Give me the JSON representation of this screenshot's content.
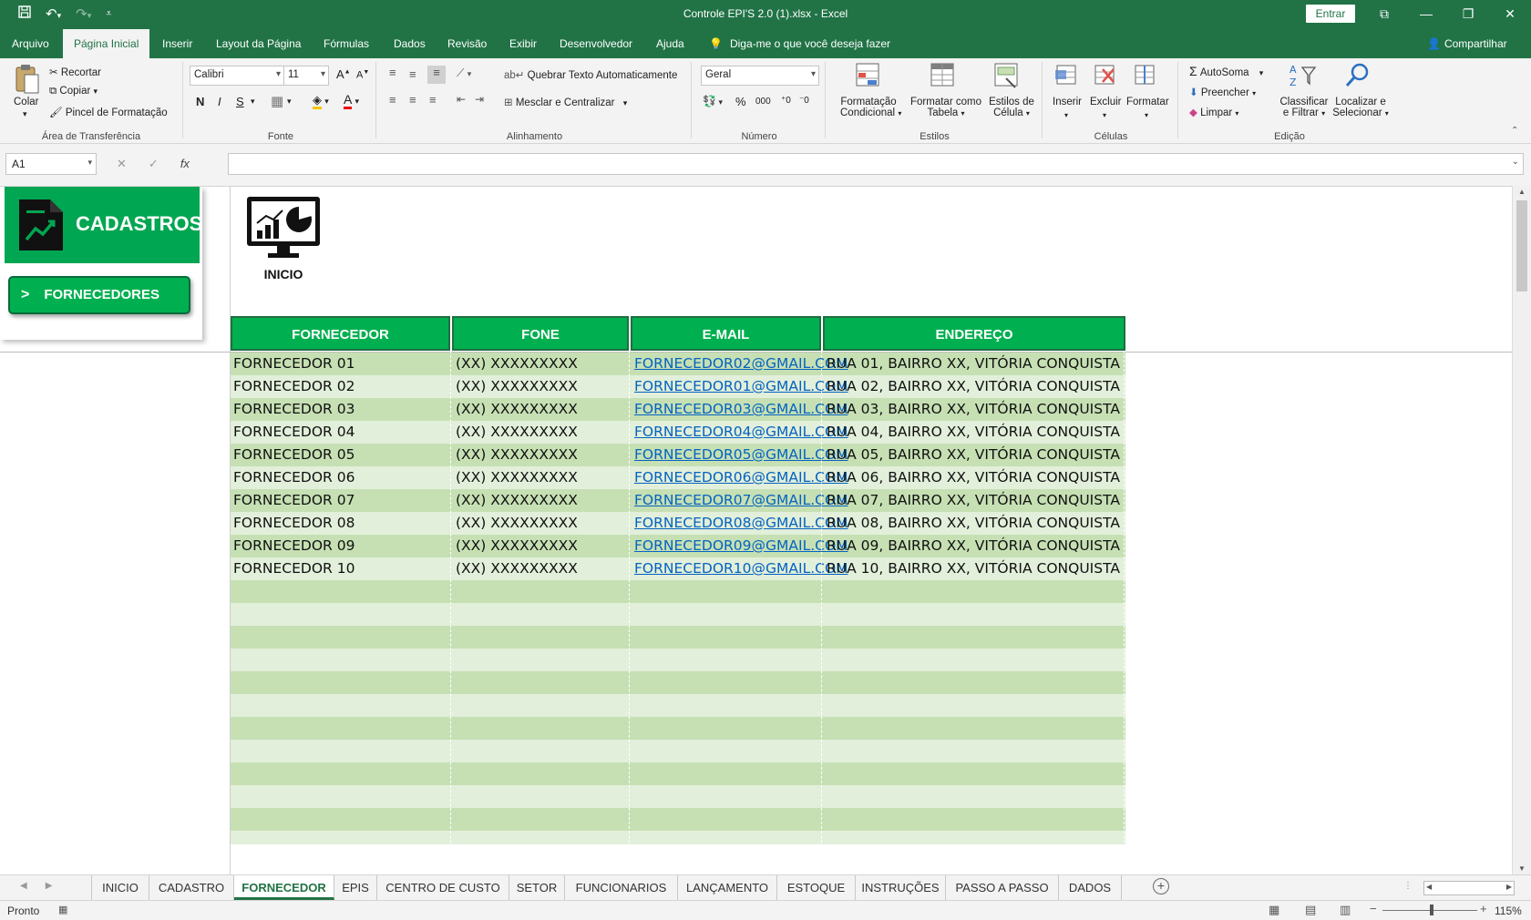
{
  "app": {
    "title": "Controle EPI'S 2.0 (1).xlsx  -  Excel",
    "signin_label": "Entrar"
  },
  "menu": {
    "tabs": [
      "Arquivo",
      "Página Inicial",
      "Inserir",
      "Layout da Página",
      "Fórmulas",
      "Dados",
      "Revisão",
      "Exibir",
      "Desenvolvedor",
      "Ajuda"
    ],
    "active_tab": "Página Inicial",
    "tell_me": "Diga-me o que você deseja fazer",
    "share": "Compartilhar"
  },
  "ribbon": {
    "clipboard": {
      "paste": "Colar",
      "cut": "Recortar",
      "copy": "Copiar",
      "format_painter": "Pincel de Formatação",
      "label": "Área de Transferência"
    },
    "font": {
      "name": "Calibri",
      "size": "11",
      "bold": "N",
      "italic": "I",
      "underline": "S",
      "label": "Fonte"
    },
    "alignment": {
      "wrap": "Quebrar Texto Automaticamente",
      "merge": "Mesclar e Centralizar",
      "label": "Alinhamento"
    },
    "number": {
      "format": "Geral",
      "label": "Número"
    },
    "styles": {
      "conditional": [
        "Formatação",
        "Condicional"
      ],
      "table": [
        "Formatar como",
        "Tabela"
      ],
      "cell": [
        "Estilos de",
        "Célula"
      ],
      "label": "Estilos"
    },
    "cells": {
      "insert": "Inserir",
      "delete": "Excluir",
      "format": "Formatar",
      "label": "Células"
    },
    "editing": {
      "autosum": "AutoSoma",
      "fill": "Preencher",
      "clear": "Limpar",
      "sort": [
        "Classificar",
        "e Filtrar"
      ],
      "find": [
        "Localizar e",
        "Selecionar"
      ],
      "label": "Edição"
    }
  },
  "formula_bar": {
    "name_box": "A1",
    "fx": "fx",
    "value": ""
  },
  "panel": {
    "title": "CADASTROS",
    "button": "FORNECEDORES",
    "button_arrow": ">",
    "inicio_label": "INICIO"
  },
  "table": {
    "headers": [
      "FORNECEDOR",
      "FONE",
      "E-MAIL",
      "ENDEREÇO"
    ],
    "rows": [
      [
        "FORNECEDOR 01",
        "(XX) XXXXXXXXX",
        "FORNECEDOR02@GMAIL.COM",
        "RUA 01, BAIRRO XX, VITÓRIA CONQUISTA"
      ],
      [
        "FORNECEDOR 02",
        "(XX) XXXXXXXXX",
        "FORNECEDOR01@GMAIL.COM",
        "RUA 02, BAIRRO XX, VITÓRIA CONQUISTA"
      ],
      [
        "FORNECEDOR 03",
        "(XX) XXXXXXXXX",
        "FORNECEDOR03@GMAIL.COM",
        "RUA 03, BAIRRO XX, VITÓRIA CONQUISTA"
      ],
      [
        "FORNECEDOR 04",
        "(XX) XXXXXXXXX",
        "FORNECEDOR04@GMAIL.COM",
        "RUA 04, BAIRRO XX, VITÓRIA CONQUISTA"
      ],
      [
        "FORNECEDOR 05",
        "(XX) XXXXXXXXX",
        "FORNECEDOR05@GMAIL.COM",
        "RUA 05, BAIRRO XX, VITÓRIA CONQUISTA"
      ],
      [
        "FORNECEDOR 06",
        "(XX) XXXXXXXXX",
        "FORNECEDOR06@GMAIL.COM",
        "RUA 06, BAIRRO XX, VITÓRIA CONQUISTA"
      ],
      [
        "FORNECEDOR 07",
        "(XX) XXXXXXXXX",
        "FORNECEDOR07@GMAIL.COM",
        "RUA 07, BAIRRO XX, VITÓRIA CONQUISTA"
      ],
      [
        "FORNECEDOR 08",
        "(XX) XXXXXXXXX",
        "FORNECEDOR08@GMAIL.COM",
        "RUA 08, BAIRRO XX, VITÓRIA CONQUISTA"
      ],
      [
        "FORNECEDOR 09",
        "(XX) XXXXXXXXX",
        "FORNECEDOR09@GMAIL.COM",
        "RUA 09, BAIRRO XX, VITÓRIA CONQUISTA"
      ],
      [
        "FORNECEDOR 10",
        "(XX) XXXXXXXXX",
        "FORNECEDOR10@GMAIL.COM",
        "RUA 10, BAIRRO XX, VITÓRIA CONQUISTA"
      ]
    ],
    "colors": {
      "header": "#00b050",
      "row_dark": "#c6e0b4",
      "row_light": "#e2efda",
      "link": "#0563c1"
    }
  },
  "sheet_tabs": {
    "tabs": [
      "INICIO",
      "CADASTRO",
      "FORNECEDOR",
      "EPIS",
      "CENTRO DE CUSTO",
      "SETOR",
      "FUNCIONARIOS",
      "LANÇAMENTO",
      "ESTOQUE",
      "INSTRUÇÕES",
      "PASSO A PASSO",
      "DADOS"
    ],
    "active": "FORNECEDOR"
  },
  "status": {
    "ready": "Pronto",
    "zoom": "115%"
  },
  "colors": {
    "excel_green": "#217346",
    "ribbon_bg": "#f3f3f3"
  }
}
